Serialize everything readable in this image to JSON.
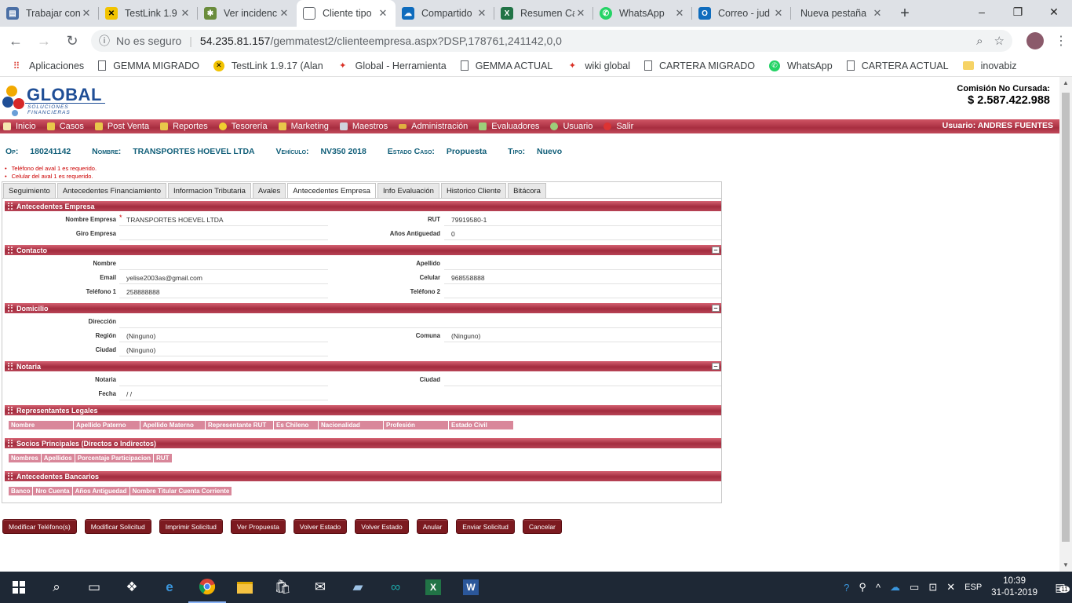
{
  "browser": {
    "tabs": [
      {
        "title": "Trabajar con",
        "icon": "document-icon",
        "color": "#4a6fa5"
      },
      {
        "title": "TestLink 1.9",
        "icon": "testlink-icon",
        "color": "#222222"
      },
      {
        "title": "Ver incidenc",
        "icon": "bug-icon",
        "color": "#6a8c3c"
      },
      {
        "title": "Cliente tipo",
        "icon": "page-icon",
        "color": "#ffffff"
      },
      {
        "title": "Compartido",
        "icon": "onedrive-icon",
        "color": "#0f6cbd"
      },
      {
        "title": "Resumen Ca",
        "icon": "excel-icon",
        "color": "#217346"
      },
      {
        "title": "WhatsApp",
        "icon": "whatsapp-icon",
        "color": "#25d366"
      },
      {
        "title": "Correo - jud",
        "icon": "outlook-icon",
        "color": "#0f6cbd"
      },
      {
        "title": "Nueva pestaña",
        "icon": "",
        "color": ""
      }
    ],
    "new_tab": "+",
    "window_controls": [
      "–",
      "❐",
      "✕"
    ],
    "address": {
      "security": "No es seguro",
      "host": "54.235.81.157",
      "path": "/gemmatest2/clienteempresa.aspx?DSP,178761,241142,0,0"
    },
    "bookmarks": [
      {
        "label": "Aplicaciones",
        "icon": "apps-grid-icon"
      },
      {
        "label": "GEMMA MIGRADO",
        "icon": "page-icon"
      },
      {
        "label": "TestLink 1.9.17 (Alan",
        "icon": "testlink-icon"
      },
      {
        "label": "Global - Herramienta",
        "icon": "global-logo-icon"
      },
      {
        "label": "GEMMA ACTUAL",
        "icon": "page-icon"
      },
      {
        "label": "wiki global",
        "icon": "global-logo-icon"
      },
      {
        "label": "CARTERA MIGRADO",
        "icon": "page-icon"
      },
      {
        "label": "WhatsApp",
        "icon": "whatsapp-icon"
      },
      {
        "label": "CARTERA ACTUAL",
        "icon": "page-icon"
      },
      {
        "label": "inovabiz",
        "icon": "folder-icon"
      }
    ]
  },
  "app": {
    "logo": {
      "name": "GLOBAL",
      "tagline": "SOLUCIONES FINANCIERAS"
    },
    "comision": {
      "label": "Comisión No Cursada:",
      "value": "$ 2.587.422.988"
    },
    "menu": [
      {
        "label": "Inicio",
        "icon": "home-icon"
      },
      {
        "label": "Casos",
        "icon": "folder-icon"
      },
      {
        "label": "Post Venta",
        "icon": "folder-icon"
      },
      {
        "label": "Reportes",
        "icon": "folder-icon"
      },
      {
        "label": "Tesorería",
        "icon": "coin-icon"
      },
      {
        "label": "Marketing",
        "icon": "folder-icon"
      },
      {
        "label": "Maestros",
        "icon": "database-icon"
      },
      {
        "label": "Administración",
        "icon": "key-icon"
      },
      {
        "label": "Evaluadores",
        "icon": "check-icon"
      },
      {
        "label": "Usuario",
        "icon": "user-icon"
      },
      {
        "label": "Salir",
        "icon": "exit-icon"
      }
    ],
    "usuario": "Usuario:  ANDRES FUENTES",
    "op_line": {
      "op_label": "Op:",
      "op": "180241142",
      "nombre_label": "Nombre:",
      "nombre": "TRANSPORTES HOEVEL LTDA",
      "vehiculo_label": "Vehículo:",
      "vehiculo": "NV350 2018",
      "estado_label": "Estado Caso:",
      "estado": "Propuesta",
      "tipo_label": "Tipo:",
      "tipo": "Nuevo"
    },
    "errors": [
      "Teléfono del aval 1 es requerido.",
      "Celular del aval 1 es requerido."
    ],
    "tabs": [
      "Seguimiento",
      "Antecedentes Financiamiento",
      "Informacion Tributaria",
      "Avales",
      "Antecedentes Empresa",
      "Info Evaluación",
      "Historico Cliente",
      "Bitácora"
    ],
    "active_tab": "Antecedentes Empresa",
    "sections": {
      "empresa": {
        "title": "Antecedentes Empresa",
        "rows": [
          {
            "l1": "Nombre Empresa",
            "v1": "TRANSPORTES HOEVEL LTDA",
            "l2": "RUT",
            "v2": "79919580-1"
          },
          {
            "l1": "Giro Empresa",
            "v1": "",
            "l2": "Años Antiguedad",
            "v2": "0"
          }
        ]
      },
      "contacto": {
        "title": "Contacto",
        "rows": [
          {
            "l1": "Nombre",
            "v1": "",
            "l2": "Apellido",
            "v2": ""
          },
          {
            "l1": "Email",
            "v1": "yelise2003as@gmail.com",
            "l2": "Celular",
            "v2": "968558888"
          },
          {
            "l1": "Teléfono 1",
            "v1": "258888888",
            "l2": "Teléfono 2",
            "v2": ""
          }
        ]
      },
      "domicilio": {
        "title": "Domicilio",
        "rows": [
          {
            "l1": "Dirección",
            "v1": "",
            "l2": "",
            "v2": ""
          },
          {
            "l1": "Región",
            "v1": "(Ninguno)",
            "l2": "Comuna",
            "v2": "(Ninguno)"
          },
          {
            "l1": "Ciudad",
            "v1": "(Ninguno)",
            "l2": "",
            "v2": ""
          }
        ]
      },
      "notaria": {
        "title": "Notaria",
        "rows": [
          {
            "l1": "Notaria",
            "v1": "",
            "l2": "Ciudad",
            "v2": ""
          },
          {
            "l1": "Fecha",
            "v1": "/ /",
            "l2": "",
            "v2": ""
          }
        ]
      },
      "representantes": {
        "title": "Representantes Legales",
        "columns": [
          "Nombre",
          "Apellido Paterno",
          "Apellido Materno",
          "Representante RUT",
          "Es Chileno",
          "Nacionalidad",
          "Profesión",
          "Estado Civil"
        ]
      },
      "socios": {
        "title": "Socios Principales (Directos o Indirectos)",
        "columns": [
          "Nombres",
          "Apellidos",
          "Porcentaje Participacion",
          "RUT"
        ]
      },
      "bancarios": {
        "title": "Antecedentes Bancarios",
        "columns": [
          "Banco",
          "Nro Cuenta",
          "Años Antiguedad",
          "Nombre Titular Cuenta Corriente"
        ]
      }
    },
    "collapse_symbol": "–",
    "actions": [
      "Modificar Teléfono(s)",
      "Modificar Solicitud",
      "Imprimir Solicitud",
      "Ver Propuesta",
      "Volver Estado",
      "Volver Estado",
      "Anular",
      "Enviar Solicitud",
      "Cancelar"
    ]
  },
  "taskbar": {
    "apps": [
      "start-icon",
      "search-icon",
      "task-view-icon",
      "dropbox-icon",
      "edge-icon",
      "chrome-icon",
      "file-explorer-icon",
      "store-icon",
      "mail-icon",
      "notes-icon",
      "arduino-icon",
      "excel-icon",
      "word-icon"
    ],
    "language": "ESP",
    "time": "10:39",
    "date": "31-01-2019",
    "notification_count": "11"
  },
  "colors": {
    "menu_red": "#a82e40",
    "button_red": "#7c1a20",
    "op_text": "#13607a",
    "error_red": "#cc0000"
  }
}
